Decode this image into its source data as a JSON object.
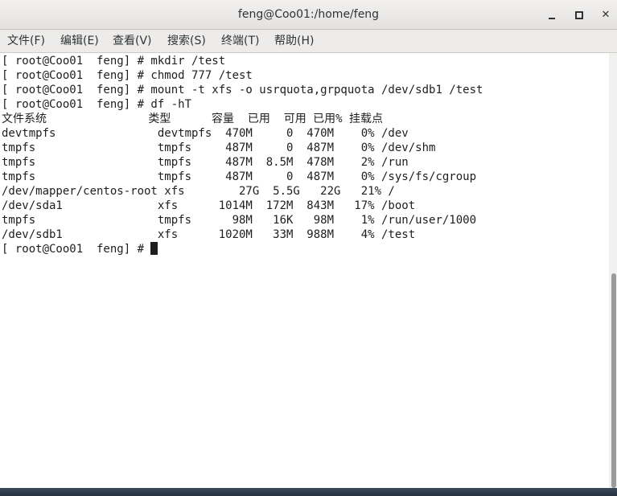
{
  "window": {
    "title": "feng@Coo01:/home/feng"
  },
  "menu": {
    "items": [
      {
        "label": "文件(F)"
      },
      {
        "label": "编辑(E)"
      },
      {
        "label": "查看(V)"
      },
      {
        "label": "搜索(S)"
      },
      {
        "label": "终端(T)"
      },
      {
        "label": "帮助(H)"
      }
    ]
  },
  "terminal": {
    "lines": [
      "[ root@Coo01  feng] # mkdir /test",
      "[ root@Coo01  feng] # chmod 777 /test",
      "[ root@Coo01  feng] # mount -t xfs -o usrquota,grpquota /dev/sdb1 /test",
      "[ root@Coo01  feng] # df -hT",
      "文件系统               类型      容量  已用  可用 已用% 挂载点",
      "devtmpfs               devtmpfs  470M     0  470M    0% /dev",
      "tmpfs                  tmpfs     487M     0  487M    0% /dev/shm",
      "tmpfs                  tmpfs     487M  8.5M  478M    2% /run",
      "tmpfs                  tmpfs     487M     0  487M    0% /sys/fs/cgroup",
      "/dev/mapper/centos-root xfs        27G  5.5G   22G   21% /",
      "/dev/sda1              xfs      1014M  172M  843M   17% /boot",
      "tmpfs                  tmpfs      98M   16K   98M    1% /run/user/1000",
      "/dev/sdb1              xfs      1020M   33M  988M    4% /test"
    ],
    "prompt": "[ root@Coo01  feng] # "
  }
}
